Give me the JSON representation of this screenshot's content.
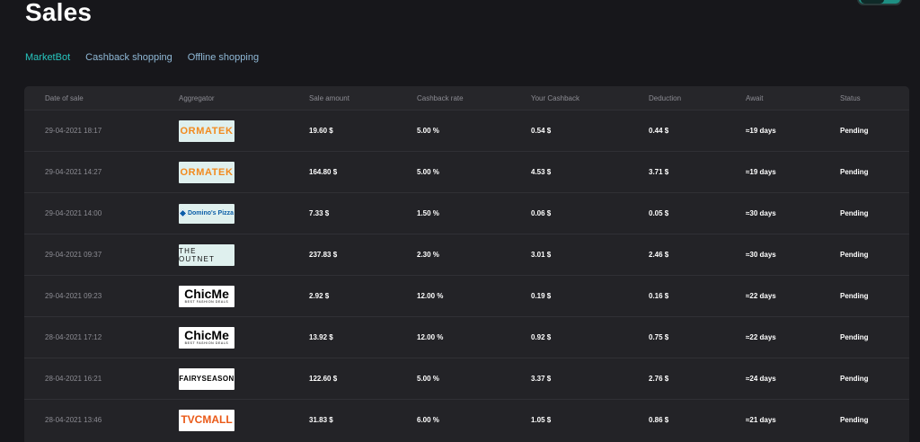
{
  "page": {
    "title": "Sales"
  },
  "tabs": [
    {
      "label": "MarketBot",
      "active": true
    },
    {
      "label": "Cashback shopping",
      "active": false
    },
    {
      "label": "Offline shopping",
      "active": false
    }
  ],
  "colors": {
    "accent": "#27c7c0",
    "tab": "#8fb8d6",
    "background": "#17171b",
    "table": "#232327"
  },
  "table": {
    "headers": [
      "Date of sale",
      "Aggregator",
      "Sale amount",
      "Cashback rate",
      "Your Cashback",
      "Deduction",
      "Await",
      "Status"
    ],
    "rows": [
      {
        "date": "29-04-2021 18:17",
        "aggregator": "ormatek",
        "logo_text": "ORMATEK",
        "amount": "19.60 $",
        "rate": "5.00 %",
        "cashback": "0.54 $",
        "deduction": "0.44 $",
        "await": "≈19 days",
        "status": "Pending"
      },
      {
        "date": "29-04-2021 14:27",
        "aggregator": "ormatek",
        "logo_text": "ORMATEK",
        "amount": "164.80 $",
        "rate": "5.00 %",
        "cashback": "4.53 $",
        "deduction": "3.71 $",
        "await": "≈19 days",
        "status": "Pending"
      },
      {
        "date": "29-04-2021 14:00",
        "aggregator": "dominos",
        "logo_text": "Domino's Pizza",
        "amount": "7.33 $",
        "rate": "1.50 %",
        "cashback": "0.06 $",
        "deduction": "0.05 $",
        "await": "≈30 days",
        "status": "Pending"
      },
      {
        "date": "29-04-2021 09:37",
        "aggregator": "outnet",
        "logo_text": "THE OUTNET",
        "amount": "237.83 $",
        "rate": "2.30 %",
        "cashback": "3.01 $",
        "deduction": "2.46 $",
        "await": "≈30 days",
        "status": "Pending"
      },
      {
        "date": "29-04-2021 09:23",
        "aggregator": "chicme",
        "logo_text": "ChicMe",
        "logo_sub": "BEST FASHION DEALS",
        "amount": "2.92 $",
        "rate": "12.00 %",
        "cashback": "0.19 $",
        "deduction": "0.16 $",
        "await": "≈22 days",
        "status": "Pending"
      },
      {
        "date": "28-04-2021 17:12",
        "aggregator": "chicme",
        "logo_text": "ChicMe",
        "logo_sub": "BEST FASHION DEALS",
        "amount": "13.92 $",
        "rate": "12.00 %",
        "cashback": "0.92 $",
        "deduction": "0.75 $",
        "await": "≈22 days",
        "status": "Pending"
      },
      {
        "date": "28-04-2021 16:21",
        "aggregator": "fairyseason",
        "logo_text": "FAIRYSEASON",
        "amount": "122.60 $",
        "rate": "5.00 %",
        "cashback": "3.37 $",
        "deduction": "2.76 $",
        "await": "≈24 days",
        "status": "Pending"
      },
      {
        "date": "28-04-2021 13:46",
        "aggregator": "tvcmall",
        "logo_text": "TVCMALL",
        "amount": "31.83 $",
        "rate": "6.00 %",
        "cashback": "1.05 $",
        "deduction": "0.86 $",
        "await": "≈21 days",
        "status": "Pending"
      }
    ]
  }
}
